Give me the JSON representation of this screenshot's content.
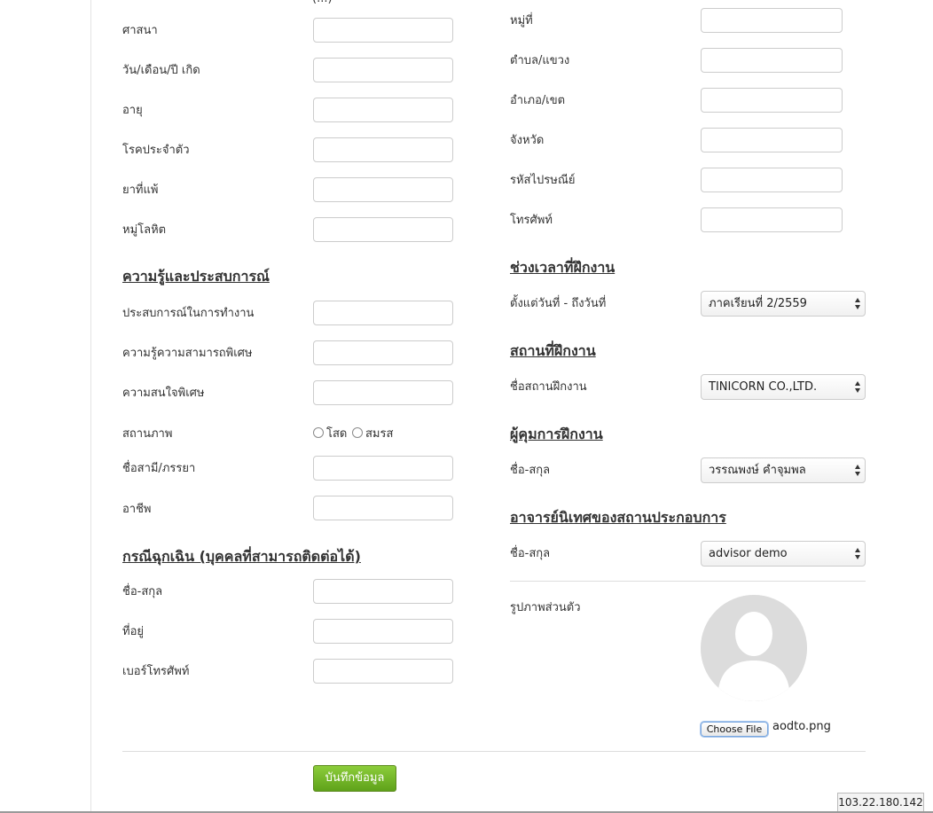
{
  "top_partial_text": "(...)",
  "left_fields": [
    {
      "label": "ศาสนา"
    },
    {
      "label": "วัน/เดือน/ปี เกิด"
    },
    {
      "label": "อายุ"
    },
    {
      "label": "โรคประจำตัว"
    },
    {
      "label": "ยาที่แพ้"
    },
    {
      "label": "หมู่โลหิต"
    }
  ],
  "experience": {
    "heading": "ความรู้และประสบการณ์",
    "fields": [
      {
        "label": "ประสบการณ์ในการทำงาน"
      },
      {
        "label": "ความรู้ความสามารถพิเศษ"
      },
      {
        "label": "ความสนใจพิเศษ"
      }
    ],
    "marital_label": "สถานภาพ",
    "marital_options": [
      "โสด",
      "สมรส"
    ],
    "spouse_label": "ชื่อสามี/ภรรยา",
    "occupation_label": "อาชีพ"
  },
  "emergency": {
    "heading": "กรณีฉุกเฉิน (บุคคลที่สามารถติดต่อได้)",
    "fields": [
      {
        "label": "ชื่อ-สกุล"
      },
      {
        "label": "ที่อยู่"
      },
      {
        "label": "เบอร์โทรศัพท์"
      }
    ]
  },
  "address_fields": [
    {
      "label": "หมู่ที่"
    },
    {
      "label": "ตำบล/แขวง"
    },
    {
      "label": "อำเภอ/เขต"
    },
    {
      "label": "จังหวัด"
    },
    {
      "label": "รหัสไปรษณีย์"
    },
    {
      "label": "โทรศัพท์"
    }
  ],
  "period": {
    "heading": "ช่วงเวลาที่ฝึกงาน",
    "label": "ตั้งแต่วันที่ - ถึงวันที่",
    "value": "ภาคเรียนที่ 2/2559"
  },
  "place": {
    "heading": "สถานที่ฝึกงาน",
    "label": "ชื่อสถานฝึกงาน",
    "value": "TINICORN CO.,LTD."
  },
  "supervisor": {
    "heading": "ผู้คุมการฝึกงาน",
    "label": "ชื่อ-สกุล",
    "value": "วรรณพงษ์ คำจุมพล"
  },
  "advisor": {
    "heading": "อาจารย์นิเทศของสถานประกอบการ",
    "label": "ชื่อ-สกุล",
    "value": "advisor demo"
  },
  "photo": {
    "label": "รูปภาพส่วนตัว",
    "choose_file": "Choose File",
    "file_name": "aodto.png"
  },
  "save_button": "บันทึกข้อมูล",
  "ip_address": "103.22.180.142"
}
